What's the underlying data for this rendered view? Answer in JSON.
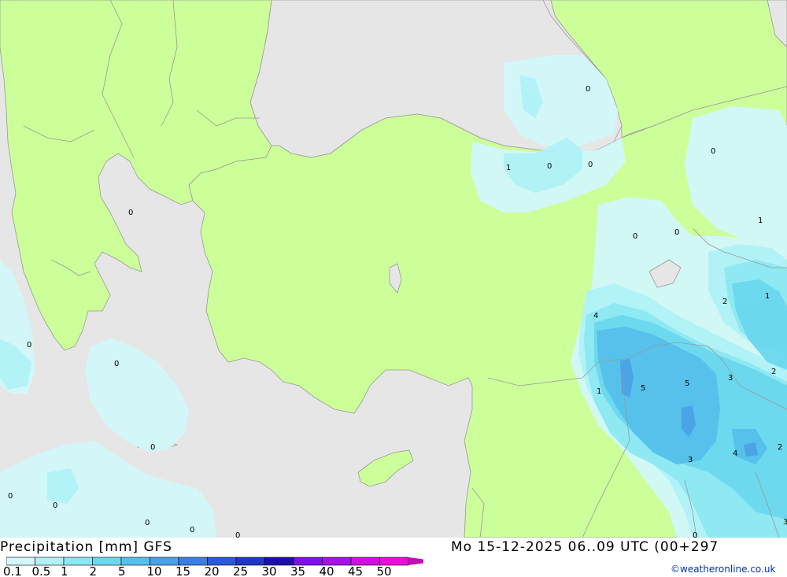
{
  "title": "Precipitation [mm] GFS",
  "valid_time": "Mo 15-12-2025 06..09 UTC (00+297",
  "credit": "©weatheronline.co.uk",
  "legend": {
    "levels": [
      "0.1",
      "0.5",
      "1",
      "2",
      "5",
      "10",
      "15",
      "20",
      "25",
      "30",
      "35",
      "40",
      "45",
      "50"
    ],
    "colors": [
      "#d2f8fa",
      "#b0f2f8",
      "#8ce8f2",
      "#6ad8ee",
      "#55c0ea",
      "#4aa2e6",
      "#3c7ee2",
      "#2a5ad8",
      "#2036c4",
      "#1c10a8",
      "#8010e8",
      "#a810e8",
      "#d010e0",
      "#e810d8",
      "#c010b0"
    ]
  },
  "map_colors": {
    "land": "#ccff99",
    "sea": "#e6e6e6",
    "border": "#999999"
  },
  "markers": [
    "0",
    "0",
    "0",
    "0",
    "1",
    "0",
    "0",
    "0",
    "1",
    "0",
    "0",
    "4",
    "2",
    "1",
    "1",
    "5",
    "5",
    "3",
    "2",
    "3",
    "4",
    "2",
    "0",
    "0",
    "0",
    "0",
    "0",
    "0",
    "0",
    "3"
  ]
}
